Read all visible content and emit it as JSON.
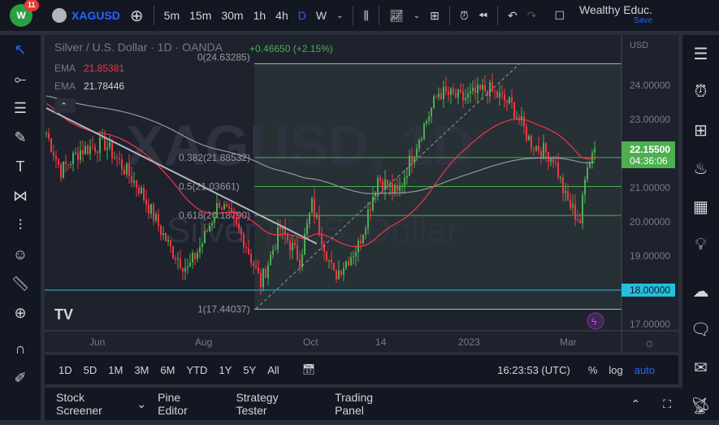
{
  "header": {
    "notif_count": "11",
    "symbol": "XAGUSD",
    "timeframes": [
      "5m",
      "15m",
      "30m",
      "1h",
      "4h",
      "D",
      "W"
    ],
    "active_timeframe": "D",
    "layout_name": "Wealthy Educ.",
    "save_label": "Save"
  },
  "legend": {
    "title": "Silver / U.S. Dollar · 1D · OANDA",
    "change": "+0.46650 (+2.15%)",
    "ema1_label": "EMA",
    "ema1_value": "21.85381",
    "ema2_label": "EMA",
    "ema2_value": "21.78446",
    "watermark1": "XAGUSD, 1D",
    "watermark2": "Silver / U.S. Dollar"
  },
  "colors": {
    "up": "#4caf50",
    "down": "#f23645",
    "accent": "#2962ff",
    "ema_fast": "#f23645",
    "ema_slow": "#9598a1",
    "cyan": "#22c1dc"
  },
  "price_axis": {
    "currency": "USD",
    "ticks": [
      "24.00000",
      "23.00000",
      "22.00000",
      "21.00000",
      "20.00000",
      "19.00000",
      "18.00000",
      "17.00000"
    ],
    "last_price": "22.15500",
    "countdown": "04:36:06",
    "level_label": "18.00000"
  },
  "time_axis": [
    "Jun",
    "Aug",
    "Oct",
    "14",
    "2023",
    "Mar"
  ],
  "fib": [
    {
      "label": "0(24.63285)",
      "level": 24.63285
    },
    {
      "label": "0.382(21.88532)",
      "level": 21.88532
    },
    {
      "label": "0.5(21.03661)",
      "level": 21.03661
    },
    {
      "label": "0.618(20.18790)",
      "level": 20.1879
    },
    {
      "label": "1(17.44037)",
      "level": 17.44037
    }
  ],
  "chart_data": {
    "type": "candlestick",
    "symbol": "XAGUSD",
    "ylim": [
      16.8,
      25.2
    ],
    "horizontal_line": 18.0,
    "close_path": [
      [
        0,
        22.6
      ],
      [
        6,
        21.5
      ],
      [
        14,
        22.1
      ],
      [
        24,
        22.3
      ],
      [
        38,
        21.0
      ],
      [
        51,
        19.2
      ],
      [
        58,
        18.6
      ],
      [
        64,
        19.4
      ],
      [
        71,
        20.6
      ],
      [
        81,
        19.5
      ],
      [
        88,
        18.2
      ],
      [
        96,
        19.8
      ],
      [
        104,
        18.9
      ],
      [
        109,
        20.5
      ],
      [
        118,
        18.4
      ],
      [
        128,
        19.3
      ],
      [
        136,
        21.3
      ],
      [
        144,
        20.8
      ],
      [
        153,
        22.5
      ],
      [
        161,
        23.8
      ],
      [
        171,
        23.6
      ],
      [
        181,
        23.9
      ],
      [
        191,
        23.4
      ],
      [
        199,
        22.3
      ],
      [
        208,
        21.9
      ],
      [
        213,
        20.7
      ],
      [
        219,
        20.0
      ],
      [
        222,
        21.8
      ],
      [
        225,
        22.155
      ]
    ]
  },
  "range_buttons": [
    "1D",
    "5D",
    "1M",
    "3M",
    "6M",
    "YTD",
    "1Y",
    "5Y",
    "All"
  ],
  "clock": "16:23:53 (UTC)",
  "scale_opts": [
    "%",
    "log",
    "auto"
  ],
  "panels": [
    "Stock Screener",
    "Pine Editor",
    "Strategy Tester",
    "Trading Panel"
  ]
}
